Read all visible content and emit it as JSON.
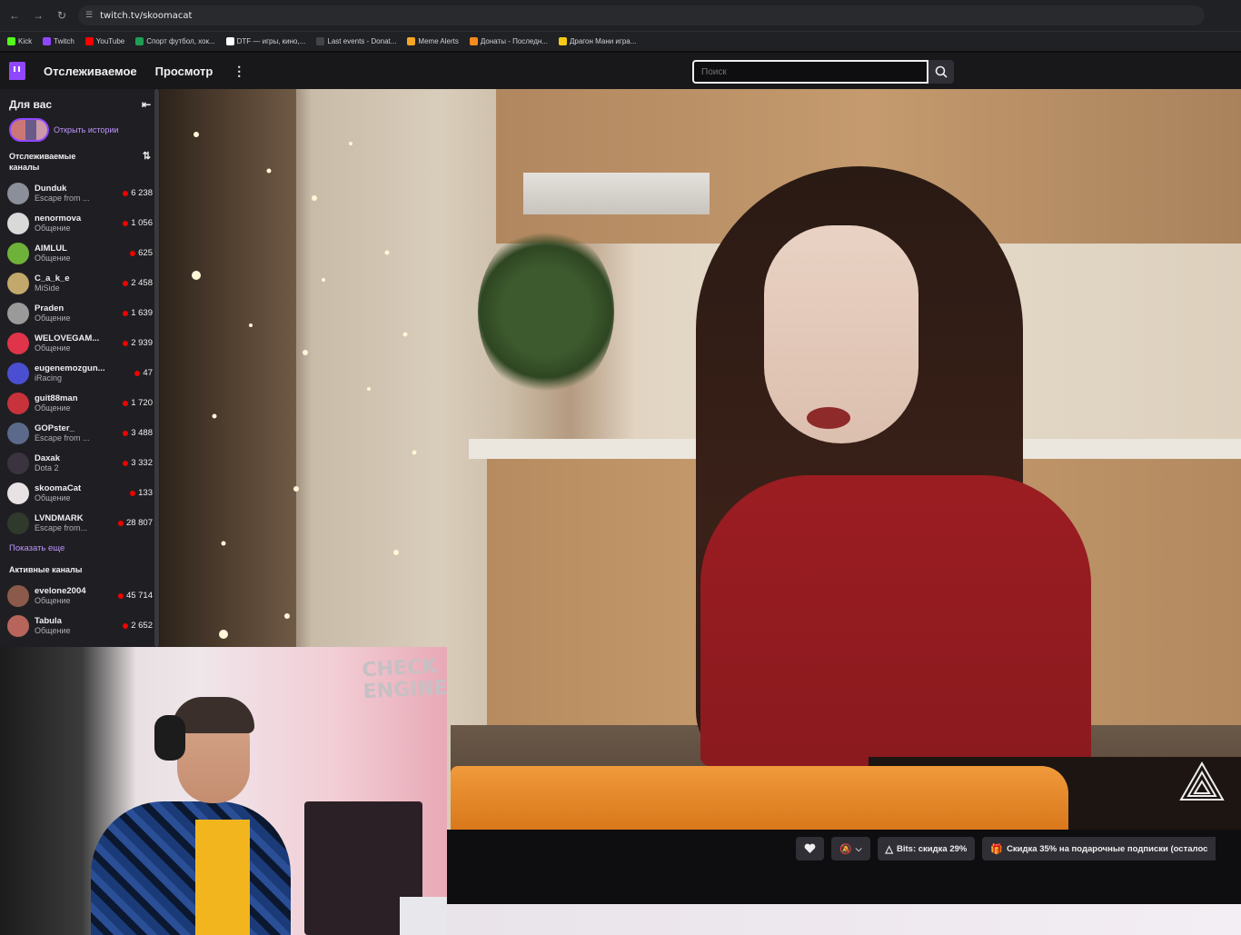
{
  "browser": {
    "url": "twitch.tv/skoomacat",
    "bookmarks": [
      {
        "label": "Kick",
        "color": "#53fc18"
      },
      {
        "label": "Twitch",
        "color": "#9147ff"
      },
      {
        "label": "YouTube",
        "color": "#ff0000"
      },
      {
        "label": "Спорт футбол, хок...",
        "color": "#1f9d55"
      },
      {
        "label": "DTF — игры, кино,...",
        "color": "#ffffff"
      },
      {
        "label": "Last events - Donat...",
        "color": "#444444"
      },
      {
        "label": "Meme Alerts",
        "color": "#f5a623"
      },
      {
        "label": "Донаты - Последн...",
        "color": "#f58a1f"
      },
      {
        "label": "Драгон Мани игра...",
        "color": "#f6c915"
      }
    ]
  },
  "nav": {
    "following": "Отслеживаемое",
    "browse": "Просмотр",
    "more": "⋮",
    "search_placeholder": "Поиск"
  },
  "sidebar": {
    "for_you": "Для вас",
    "open_stories": "Открыть истории",
    "followed_title": "Отслеживаемые каналы",
    "followed": [
      {
        "name": "Dunduk",
        "game": "Escape from ...",
        "viewers": "6 238",
        "avatar": "#8a8f99"
      },
      {
        "name": "nenormova",
        "game": "Общение",
        "viewers": "1 056",
        "avatar": "#d9d9d9"
      },
      {
        "name": "AIMLUL",
        "game": "Общение",
        "viewers": "625",
        "avatar": "#6fb23a"
      },
      {
        "name": "C_a_k_e",
        "game": "MiSide",
        "viewers": "2 458",
        "avatar": "#c2a86a"
      },
      {
        "name": "Praden",
        "game": "Общение",
        "viewers": "1 639",
        "avatar": "#9a9a9a"
      },
      {
        "name": "WELOVEGAM...",
        "game": "Общение",
        "viewers": "2 939",
        "avatar": "#e0344b"
      },
      {
        "name": "eugenemozgun...",
        "game": "iRacing",
        "viewers": "47",
        "avatar": "#4a4fd1"
      },
      {
        "name": "guit88man",
        "game": "Общение",
        "viewers": "1 720",
        "avatar": "#c8323a"
      },
      {
        "name": "GOPster_",
        "game": "Escape from ...",
        "viewers": "3 488",
        "avatar": "#5b6a8a"
      },
      {
        "name": "Daxak",
        "game": "Dota 2",
        "viewers": "3 332",
        "avatar": "#3b3340"
      },
      {
        "name": "skoomaCat",
        "game": "Общение",
        "viewers": "133",
        "avatar": "#e8e2e4"
      },
      {
        "name": "LVNDMARK",
        "game": "Escape from...",
        "viewers": "28 807",
        "avatar": "#2f3a2c"
      }
    ],
    "show_more": "Показать еще",
    "active_title": "Активные каналы",
    "active": [
      {
        "name": "evelone2004",
        "game": "Общение",
        "viewers": "45 714",
        "avatar": "#8b5a4a"
      },
      {
        "name": "Tabula",
        "game": "Общение",
        "viewers": "2 652",
        "avatar": "#b7655a"
      }
    ]
  },
  "player": {
    "actions": {
      "bits": "Bits: скидка 29%",
      "gift": "Скидка 35% на подарочные подписки (осталос"
    }
  },
  "pip": {
    "logo_line1": "CHECK",
    "logo_line2": "ENGINE"
  },
  "colors": {
    "twitch_purple": "#9147ff",
    "live_red": "#eb0400",
    "link_purple": "#bf94ff"
  }
}
